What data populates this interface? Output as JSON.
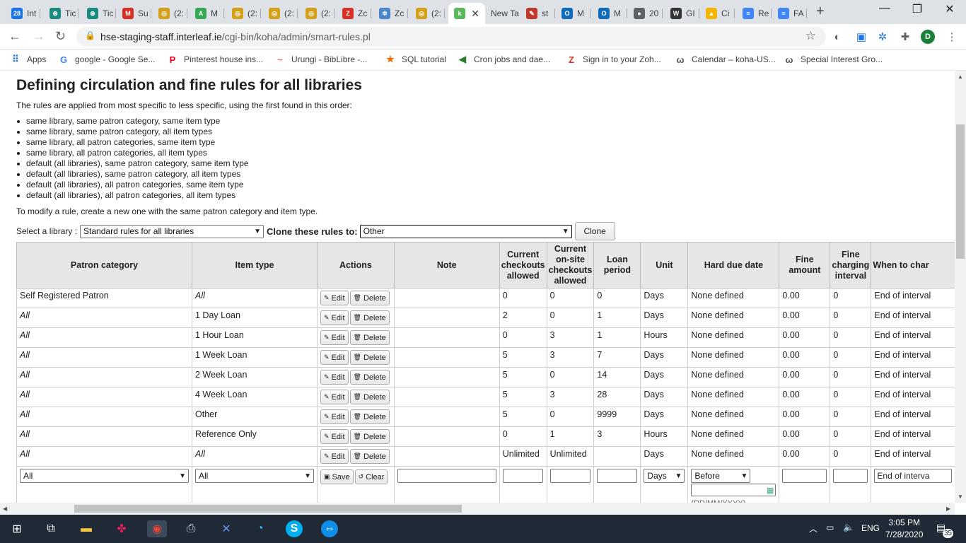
{
  "browser": {
    "tabs": [
      {
        "label": "Int",
        "fav": "28",
        "color": "#1a73e8"
      },
      {
        "label": "Tic",
        "fav": "⊛",
        "color": "#1b8a7e"
      },
      {
        "label": "Tic",
        "fav": "⊛",
        "color": "#1b8a7e"
      },
      {
        "label": "Su",
        "fav": "M",
        "color": "#d93025"
      },
      {
        "label": "(2:",
        "fav": "◎",
        "color": "#d4a017"
      },
      {
        "label": "M",
        "fav": "A",
        "color": "#34a853"
      },
      {
        "label": "(2:",
        "fav": "◎",
        "color": "#d4a017"
      },
      {
        "label": "(2:",
        "fav": "◎",
        "color": "#d4a017"
      },
      {
        "label": "(2:",
        "fav": "◎",
        "color": "#d4a017"
      },
      {
        "label": "Zc",
        "fav": "Z",
        "color": "#d93025"
      },
      {
        "label": "Zc",
        "fav": "✲",
        "color": "#4a86c8"
      },
      {
        "label": "(2:",
        "fav": "◎",
        "color": "#d4a017"
      },
      {
        "label": "",
        "fav": "k",
        "color": "#5bb85c",
        "active": true
      },
      {
        "label": "New Ta",
        "fav": "",
        "color": ""
      },
      {
        "label": "st",
        "fav": "✎",
        "color": "#c0392b"
      },
      {
        "label": "M",
        "fav": "O",
        "color": "#0f6cbd"
      },
      {
        "label": "M",
        "fav": "O",
        "color": "#0f6cbd"
      },
      {
        "label": "20",
        "fav": "●",
        "color": "#5f6368"
      },
      {
        "label": "GI",
        "fav": "W",
        "color": "#333333"
      },
      {
        "label": "Ci",
        "fav": "▲",
        "color": "#f4b400"
      },
      {
        "label": "Re",
        "fav": "≡",
        "color": "#4285f4"
      },
      {
        "label": "FA",
        "fav": "≡",
        "color": "#4285f4"
      }
    ],
    "new_tab_glyph": "+",
    "close_glyph": "✕",
    "minimize_glyph": "—",
    "maximize_glyph": "❐",
    "window_close_glyph": "✕",
    "url_host": "hse-staging-staff.interleaf.ie",
    "url_path": "/cgi-bin/koha/admin/smart-rules.pl",
    "profile_initial": "D",
    "bookmarks": [
      {
        "label": "Apps",
        "fav": "⠿",
        "color": "#1a73e8"
      },
      {
        "label": "google - Google Se...",
        "fav": "G",
        "color": "#4285f4"
      },
      {
        "label": "Pinterest house ins...",
        "fav": "P",
        "color": "#e60023"
      },
      {
        "label": "Urungi - BibLibre -...",
        "fav": "~",
        "color": "#e57373"
      },
      {
        "label": "SQL tutorial",
        "fav": "★",
        "color": "#ef6c00"
      },
      {
        "label": "Cron jobs and dae...",
        "fav": "◀",
        "color": "#2e7d32"
      },
      {
        "label": "Sign in to your Zoh...",
        "fav": "Z",
        "color": "#d93025"
      },
      {
        "label": "Calendar – koha-US...",
        "fav": "ω",
        "color": "#555555"
      },
      {
        "label": "Special Interest Gro...",
        "fav": "ω",
        "color": "#555555"
      }
    ]
  },
  "page": {
    "title": "Defining circulation and fine rules for all libraries",
    "intro": "The rules are applied from most specific to less specific, using the first found in this order:",
    "rules": [
      "same library, same patron category, same item type",
      "same library, same patron category, all item types",
      "same library, all patron categories, same item type",
      "same library, all patron categories, all item types",
      "default (all libraries), same patron category, same item type",
      "default (all libraries), same patron category, all item types",
      "default (all libraries), all patron categories, same item type",
      "default (all libraries), all patron categories, all item types"
    ],
    "modify_note": "To modify a rule, create a new one with the same patron category and item type.",
    "select_library_label": "Select a library :",
    "select_library_value": "Standard rules for all libraries",
    "clone_label": "Clone these rules to:",
    "clone_value": "Other",
    "clone_button": "Clone"
  },
  "table": {
    "headers": [
      "Patron category",
      "Item type",
      "Actions",
      "Note",
      "Current checkouts allowed",
      "Current on-site checkouts allowed",
      "Loan period",
      "Unit",
      "Hard due date",
      "Fine amount",
      "Fine charging interval",
      "When to char"
    ],
    "edit_label": "Edit",
    "delete_label": "Delete",
    "rows": [
      {
        "patron": "Self Registered Patron",
        "patron_all": false,
        "item": "All",
        "item_all": true,
        "checkouts": "0",
        "onsite": "0",
        "loan": "0",
        "unit": "Days",
        "hard": "None defined",
        "fine": "0.00",
        "interval": "0",
        "when": "End of interval"
      },
      {
        "patron": "All",
        "patron_all": true,
        "item": "1 Day Loan",
        "item_all": false,
        "checkouts": "2",
        "onsite": "0",
        "loan": "1",
        "unit": "Days",
        "hard": "None defined",
        "fine": "0.00",
        "interval": "0",
        "when": "End of interval"
      },
      {
        "patron": "All",
        "patron_all": true,
        "item": "1 Hour Loan",
        "item_all": false,
        "checkouts": "0",
        "onsite": "3",
        "loan": "1",
        "unit": "Hours",
        "hard": "None defined",
        "fine": "0.00",
        "interval": "0",
        "when": "End of interval"
      },
      {
        "patron": "All",
        "patron_all": true,
        "item": "1 Week Loan",
        "item_all": false,
        "checkouts": "5",
        "onsite": "3",
        "loan": "7",
        "unit": "Days",
        "hard": "None defined",
        "fine": "0.00",
        "interval": "0",
        "when": "End of interval"
      },
      {
        "patron": "All",
        "patron_all": true,
        "item": "2 Week Loan",
        "item_all": false,
        "checkouts": "5",
        "onsite": "0",
        "loan": "14",
        "unit": "Days",
        "hard": "None defined",
        "fine": "0.00",
        "interval": "0",
        "when": "End of interval"
      },
      {
        "patron": "All",
        "patron_all": true,
        "item": "4 Week Loan",
        "item_all": false,
        "checkouts": "5",
        "onsite": "3",
        "loan": "28",
        "unit": "Days",
        "hard": "None defined",
        "fine": "0.00",
        "interval": "0",
        "when": "End of interval"
      },
      {
        "patron": "All",
        "patron_all": true,
        "item": "Other",
        "item_all": false,
        "checkouts": "5",
        "onsite": "0",
        "loan": "9999",
        "unit": "Days",
        "hard": "None defined",
        "fine": "0.00",
        "interval": "0",
        "when": "End of interval"
      },
      {
        "patron": "All",
        "patron_all": true,
        "item": "Reference Only",
        "item_all": false,
        "checkouts": "0",
        "onsite": "1",
        "loan": "3",
        "unit": "Hours",
        "hard": "None defined",
        "fine": "0.00",
        "interval": "0",
        "when": "End of interval"
      },
      {
        "patron": "All",
        "patron_all": true,
        "item": "All",
        "item_all": true,
        "checkouts": "Unlimited",
        "onsite": "Unlimited",
        "loan": "",
        "unit": "Days",
        "hard": "None defined",
        "fine": "0.00",
        "interval": "0",
        "when": "End of interval"
      }
    ],
    "new_row": {
      "patron_select": "All",
      "item_select": "All",
      "save_label": "Save",
      "clear_label": "Clear",
      "unit_select": "Days",
      "hard_select": "Before",
      "date_hint": "(DD/MM/YYYY)",
      "when_select": "End of interva"
    }
  },
  "taskbar": {
    "language": "ENG",
    "time": "3:05 PM",
    "date": "7/28/2020",
    "notifications": "35"
  }
}
